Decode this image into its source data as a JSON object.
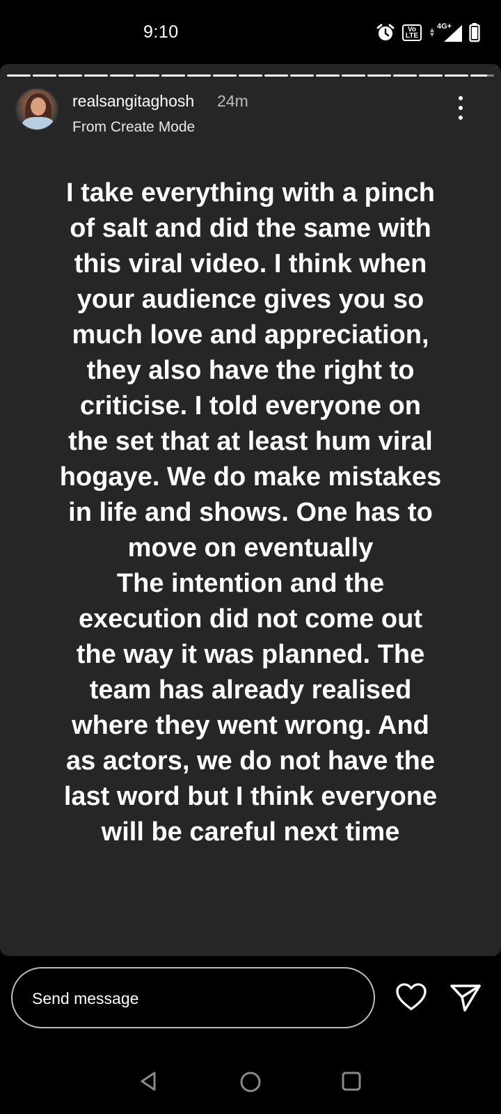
{
  "status_bar": {
    "time": "9:10",
    "volte_label": "Vo LTE",
    "network_label": "4G+",
    "icons": [
      "alarm-icon",
      "volte-icon",
      "signal-icon",
      "battery-icon"
    ]
  },
  "story": {
    "progress_total_segments": 19,
    "progress_completed_segments": 18,
    "username": "realsangitaghosh",
    "time_ago": "24m",
    "subtitle": "From Create Mode",
    "text": "I take everything with a pinch\nof salt and did the same with\nthis viral video. I think when\nyour audience gives you so\nmuch love and appreciation,\nthey also have the right to\ncriticise. I told everyone on\nthe set that at least hum viral\nhogaye. We do make mistakes\nin life and shows. One has to\nmove on eventually\nThe intention and the\nexecution did not come out\nthe way it was planned. The\nteam has already realised\nwhere they went wrong. And\nas actors, we do not have the\nlast word but I think everyone\nwill be careful next time",
    "background_color": "#262626"
  },
  "reply": {
    "placeholder": "Send message"
  },
  "nav": {
    "icons": [
      "back-icon",
      "home-icon",
      "recents-icon"
    ]
  }
}
